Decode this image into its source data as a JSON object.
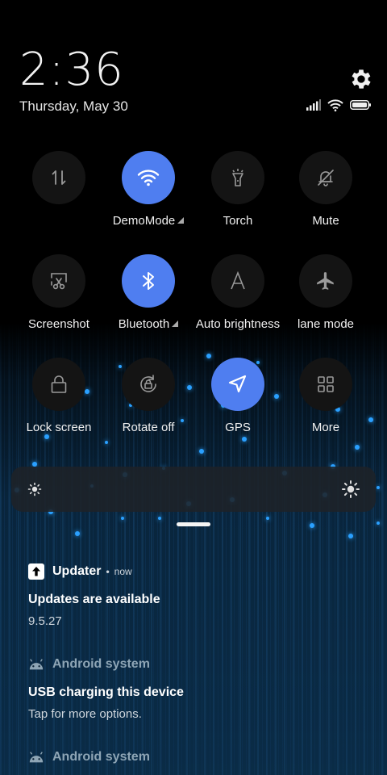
{
  "header": {
    "time": "2:36",
    "date": "Thursday, May 30"
  },
  "status_icons": [
    "signal-icon",
    "wifi-icon",
    "battery-icon"
  ],
  "toggles": [
    {
      "label": "",
      "icon": "data-transfer-icon",
      "active": false
    },
    {
      "label": "DemoMode",
      "icon": "wifi-icon",
      "active": true,
      "has_more": true
    },
    {
      "label": "Torch",
      "icon": "flashlight-icon",
      "active": false
    },
    {
      "label": "Mute",
      "icon": "bell-off-icon",
      "active": false
    },
    {
      "label": "Screenshot",
      "icon": "screenshot-icon",
      "active": false
    },
    {
      "label": "Bluetooth",
      "icon": "bluetooth-icon",
      "active": true,
      "has_more": true
    },
    {
      "label": "Auto brightness",
      "icon": "auto-brightness-icon",
      "active": false
    },
    {
      "label": "lane mode",
      "icon": "airplane-icon",
      "active": false
    },
    {
      "label": "Lock screen",
      "icon": "lock-icon",
      "active": false
    },
    {
      "label": "Rotate off",
      "icon": "rotate-lock-icon",
      "active": false
    },
    {
      "label": "GPS",
      "icon": "location-icon",
      "active": true
    },
    {
      "label": "More",
      "icon": "grid-icon",
      "active": false
    }
  ],
  "notifications": [
    {
      "app": "Updater",
      "time": "now",
      "title": "Updates are available",
      "text": "9.5.27"
    },
    {
      "app": "Android system",
      "title": "USB charging this device",
      "text": "Tap for more options."
    },
    {
      "app": "Android system"
    }
  ],
  "colors": {
    "accent": "#4f7ef0",
    "tile_off": "#141414",
    "glow": "#2aa0ff"
  }
}
